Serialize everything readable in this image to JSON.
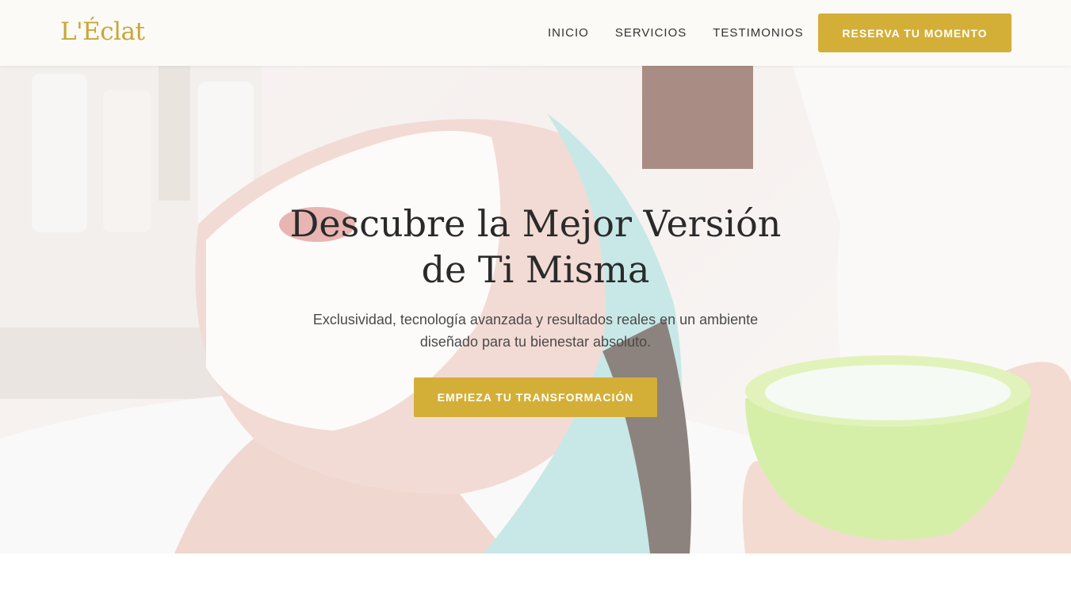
{
  "brand": {
    "logo_text": "L'Éclat",
    "accent_color": "#d4af37"
  },
  "nav": {
    "links": [
      {
        "label": "INICIO"
      },
      {
        "label": "SERVICIOS"
      },
      {
        "label": "TESTIMONIOS"
      }
    ],
    "cta_label": "RESERVA TU MOMENTO"
  },
  "hero": {
    "title": "Descubre la Mejor Versión de Ti Misma",
    "subtitle": "Exclusividad, tecnología avanzada y resultados reales en un ambiente diseñado para tu bienestar absoluto.",
    "cta_label": "EMPIEZA TU TRANSFORMACIÓN",
    "background_image": "woman-facial-mask-spa-photo"
  }
}
